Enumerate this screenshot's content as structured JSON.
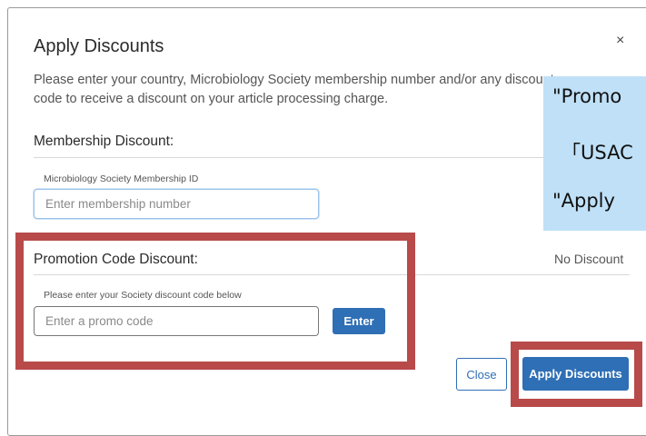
{
  "dialog": {
    "title": "Apply Discounts",
    "close_glyph": "×",
    "intro": "Please enter your country, Microbiology Society membership number and/or any discount code to receive a discount on your article processing charge."
  },
  "membership": {
    "section_title": "Membership Discount:",
    "field_label": "Microbiology Society Membership ID",
    "placeholder": "Enter membership number",
    "value": ""
  },
  "promotion": {
    "section_title": "Promotion Code Discount:",
    "field_label": "Please enter your Society discount code below",
    "placeholder": "Enter a promo code",
    "value": "",
    "enter_label": "Enter",
    "discount_status": "No Discount"
  },
  "footer": {
    "close_label": "Close",
    "apply_label": "Apply Discounts"
  },
  "overlay_note": {
    "lines": [
      "\"Promo",
      "「USAC",
      "\"Apply"
    ]
  },
  "colors": {
    "accent": "#2f6fb5",
    "highlight": "#b84a4a",
    "note_bg": "#bfe0f7"
  }
}
